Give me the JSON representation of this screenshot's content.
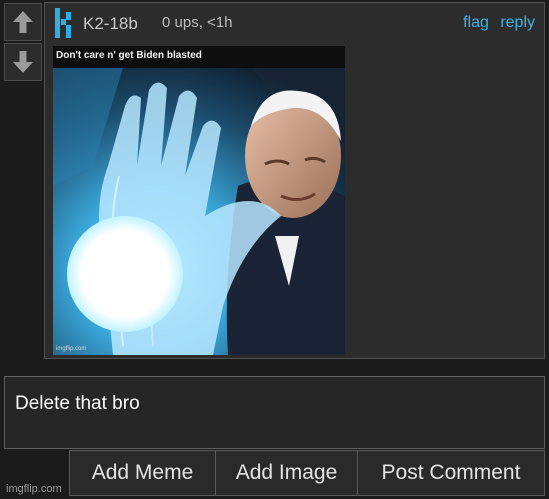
{
  "vote": {
    "upvote_icon": "arrow-up-icon",
    "downvote_icon": "arrow-down-icon"
  },
  "comment": {
    "avatar_icon": "imgflip-k-logo-icon",
    "username": "K2-18b",
    "meta": "0 ups, <1h",
    "actions": {
      "flag": "flag",
      "reply": "reply"
    },
    "meme": {
      "caption": "Don't care n'      get Biden blasted",
      "watermark": "imgflip.com"
    }
  },
  "reply": {
    "text": "Delete that bro"
  },
  "buttons": {
    "add_meme": "Add Meme",
    "add_image": "Add Image",
    "post_comment": "Post Comment"
  },
  "footer": {
    "site": "imgflip.com"
  },
  "colors": {
    "link": "#3ab2e8",
    "background": "#1b1b1b",
    "panel": "#2c2c2c",
    "avatar": "#2ab0e6"
  }
}
